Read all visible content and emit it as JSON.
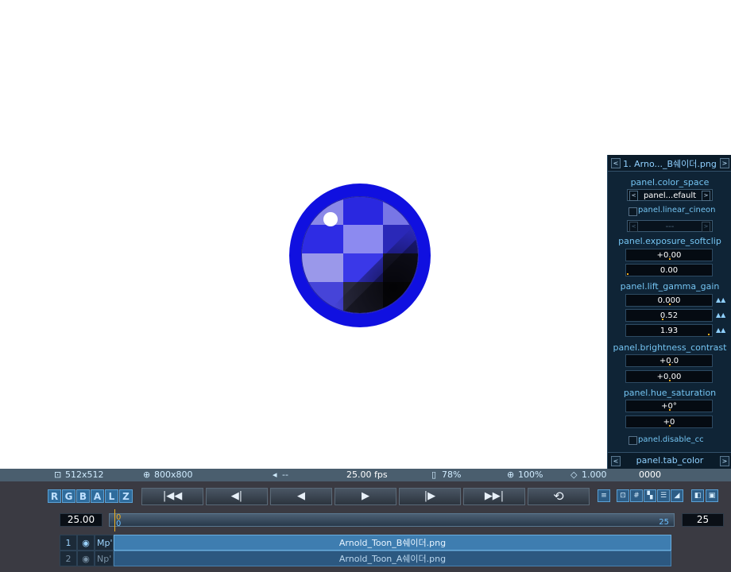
{
  "panel": {
    "title": "1. Arno..._B쉐이더.png",
    "color_space_label": "panel.color_space",
    "color_space_value": "panel...efault",
    "linear_cineon_label": "panel.linear_cineon",
    "linear_cineon_value": "---",
    "exposure_softclip_label": "panel.exposure_softclip",
    "exposure_value": "+0.00",
    "softclip_value": "0.00",
    "lift_gamma_gain_label": "panel.lift_gamma_gain",
    "lift_value": "0.000",
    "gamma_value": "0.52",
    "gain_value": "1.93",
    "brightness_contrast_label": "panel.brightness_contrast",
    "brightness_value": "+0.0",
    "contrast_value": "+0.00",
    "hue_saturation_label": "panel.hue_saturation",
    "hue_value": "+0°",
    "saturation_value": "+0",
    "disable_cc_label": "panel.disable_cc",
    "tab_label": "panel.tab_color"
  },
  "status": {
    "image_size": "512x512",
    "window_size": "800x800",
    "audio": "--",
    "fps": "25.00 fps",
    "cache": "78%",
    "zoom": "100%",
    "pixel_aspect": "1.000",
    "frame": "0000"
  },
  "channels": [
    "R",
    "G",
    "B",
    "A",
    "L",
    "Z"
  ],
  "transport": {
    "first": "|◀◀",
    "prev_key": "◀|",
    "prev": "◀",
    "play": "▶",
    "next_key": "|▶",
    "last": "▶▶|",
    "loop": "⟲"
  },
  "timeline": {
    "fps_value": "25.00",
    "start_marker": "0",
    "start_label": "0",
    "end_label": "25",
    "end_value": "25"
  },
  "layers": [
    {
      "index": "1",
      "blend": "Mp'",
      "name": "Arnold_Toon_B쉐이더.png"
    },
    {
      "index": "2",
      "blend": "Np'",
      "name": "Arnold_Toon_A쉐이더.png"
    }
  ],
  "colors": {
    "panel_bg": "#0f2436",
    "panel_text": "#74c4f2",
    "status_bg": "#4a5e6e",
    "controls_bg": "#3a3a42",
    "accent": "#5aa0d4",
    "marker": "#f0b020",
    "ball_rim": "#1010e0"
  }
}
